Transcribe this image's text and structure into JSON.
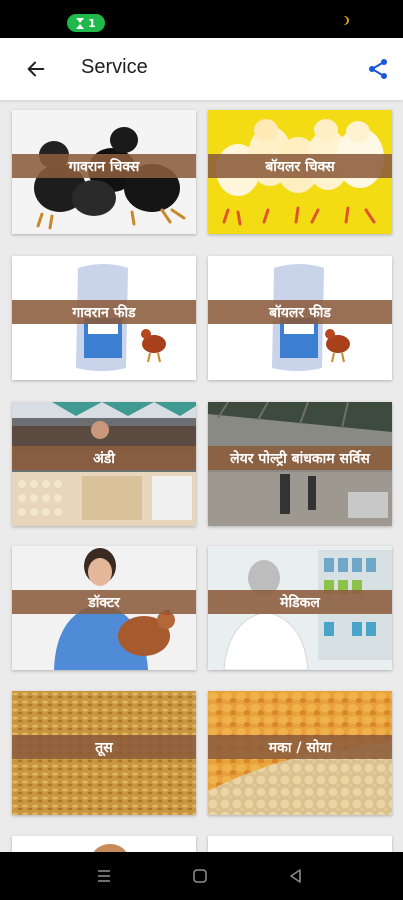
{
  "status": {
    "notification_count": "1",
    "pill_color": "#1fb84a"
  },
  "app_bar": {
    "title": "Service",
    "back_icon": "arrow-left-icon",
    "share_icon": "share-icon",
    "accent_color": "#1a56d6"
  },
  "services": [
    {
      "label": "गावरान चिक्स",
      "art": "black-chicks"
    },
    {
      "label": "बॉयलर चिक्स",
      "art": "yellow-chicks"
    },
    {
      "label": "गावरान फीड",
      "art": "feed-sack"
    },
    {
      "label": "बॉयलर फीड",
      "art": "feed-sack"
    },
    {
      "label": "अंडी",
      "art": "egg-market"
    },
    {
      "label": "लेयर पोल्ट्री बांधकाम सर्विस",
      "art": "poultry-shed"
    },
    {
      "label": "डॉक्टर",
      "art": "doctor"
    },
    {
      "label": "मेडिकल",
      "art": "pharmacy"
    },
    {
      "label": "तूस",
      "art": "husk"
    },
    {
      "label": "मका / सोया",
      "art": "maize-soya"
    }
  ],
  "band_color": "#8c5c3c",
  "nav": {
    "recents_icon": "recents-icon",
    "home_icon": "home-icon",
    "back_icon": "nav-back-icon"
  }
}
